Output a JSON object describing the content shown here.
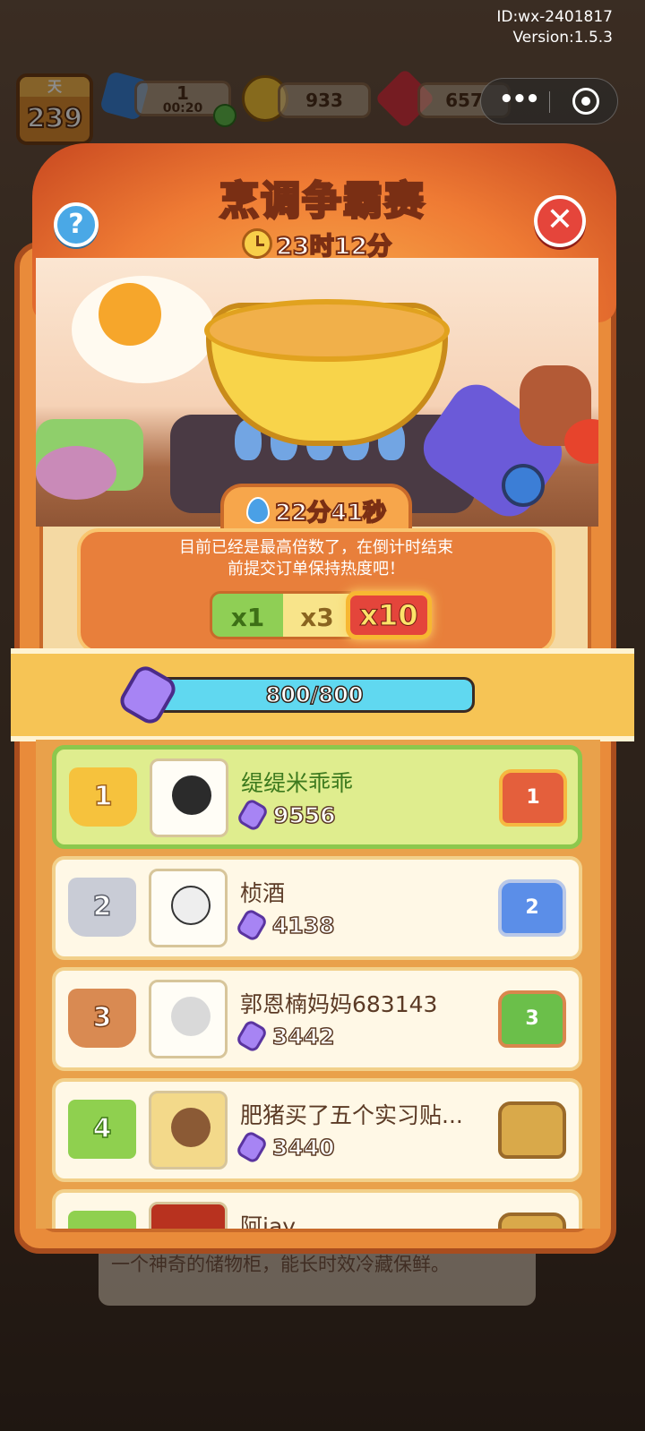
{
  "meta": {
    "id_label": "ID:wx-2401817",
    "version_label": "Version:1.5.3"
  },
  "hud": {
    "day_label": "天",
    "day_value": "239",
    "energy_value": "1",
    "energy_timer": "00:20",
    "coins": "933",
    "gems": "657"
  },
  "popup": {
    "title": "烹调争霸赛",
    "countdown": "23时12分",
    "heat_timer": "22分41秒",
    "heat_message_line1": "目前已经是最高倍数了，在倒计时结束",
    "heat_message_line2": "前提交订单保持热度吧！",
    "multipliers": [
      "x1",
      "x3",
      "x10"
    ],
    "selected_multiplier": "x10",
    "progress_text": "800/800",
    "progress_fraction": 1.0
  },
  "leaderboard": [
    {
      "rank": "1",
      "name": "缇缇米乖乖",
      "score": "9556"
    },
    {
      "rank": "2",
      "name": "桢酒",
      "score": "4138"
    },
    {
      "rank": "3",
      "name": "郭恩楠妈妈683143",
      "score": "3442"
    },
    {
      "rank": "4",
      "name": "肥猪买了五个实习贴...",
      "score": "3440"
    },
    {
      "rank": "",
      "name": "阿jay",
      "score": ""
    }
  ],
  "background_description_text": "一个神奇的储物柜，能长时效冷藏保鲜。",
  "colors": {
    "accent_orange": "#e98b3a",
    "progress_cyan": "#60d8f0",
    "close_red": "#e5453b",
    "help_blue": "#4aa8e6"
  }
}
